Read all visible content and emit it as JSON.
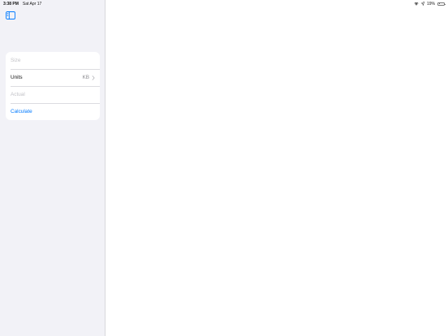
{
  "status_bar": {
    "time": "3:38 PM",
    "date": "Sat Apr 17",
    "battery_text": "19%",
    "battery_level": 0.19
  },
  "sidebar": {
    "toggle_icon": "sidebar-toggle-icon",
    "form": {
      "size_placeholder": "Size",
      "size_value": "",
      "units_label": "Units",
      "units_value": "KB",
      "actual_placeholder": "Actual",
      "actual_value": "",
      "calculate_label": "Calculate"
    }
  },
  "colors": {
    "accent": "#007aff",
    "sidebar_bg": "#f2f2f7",
    "card_bg": "#ffffff",
    "placeholder": "#c2c2c7",
    "secondary_text": "#8e8e93"
  }
}
